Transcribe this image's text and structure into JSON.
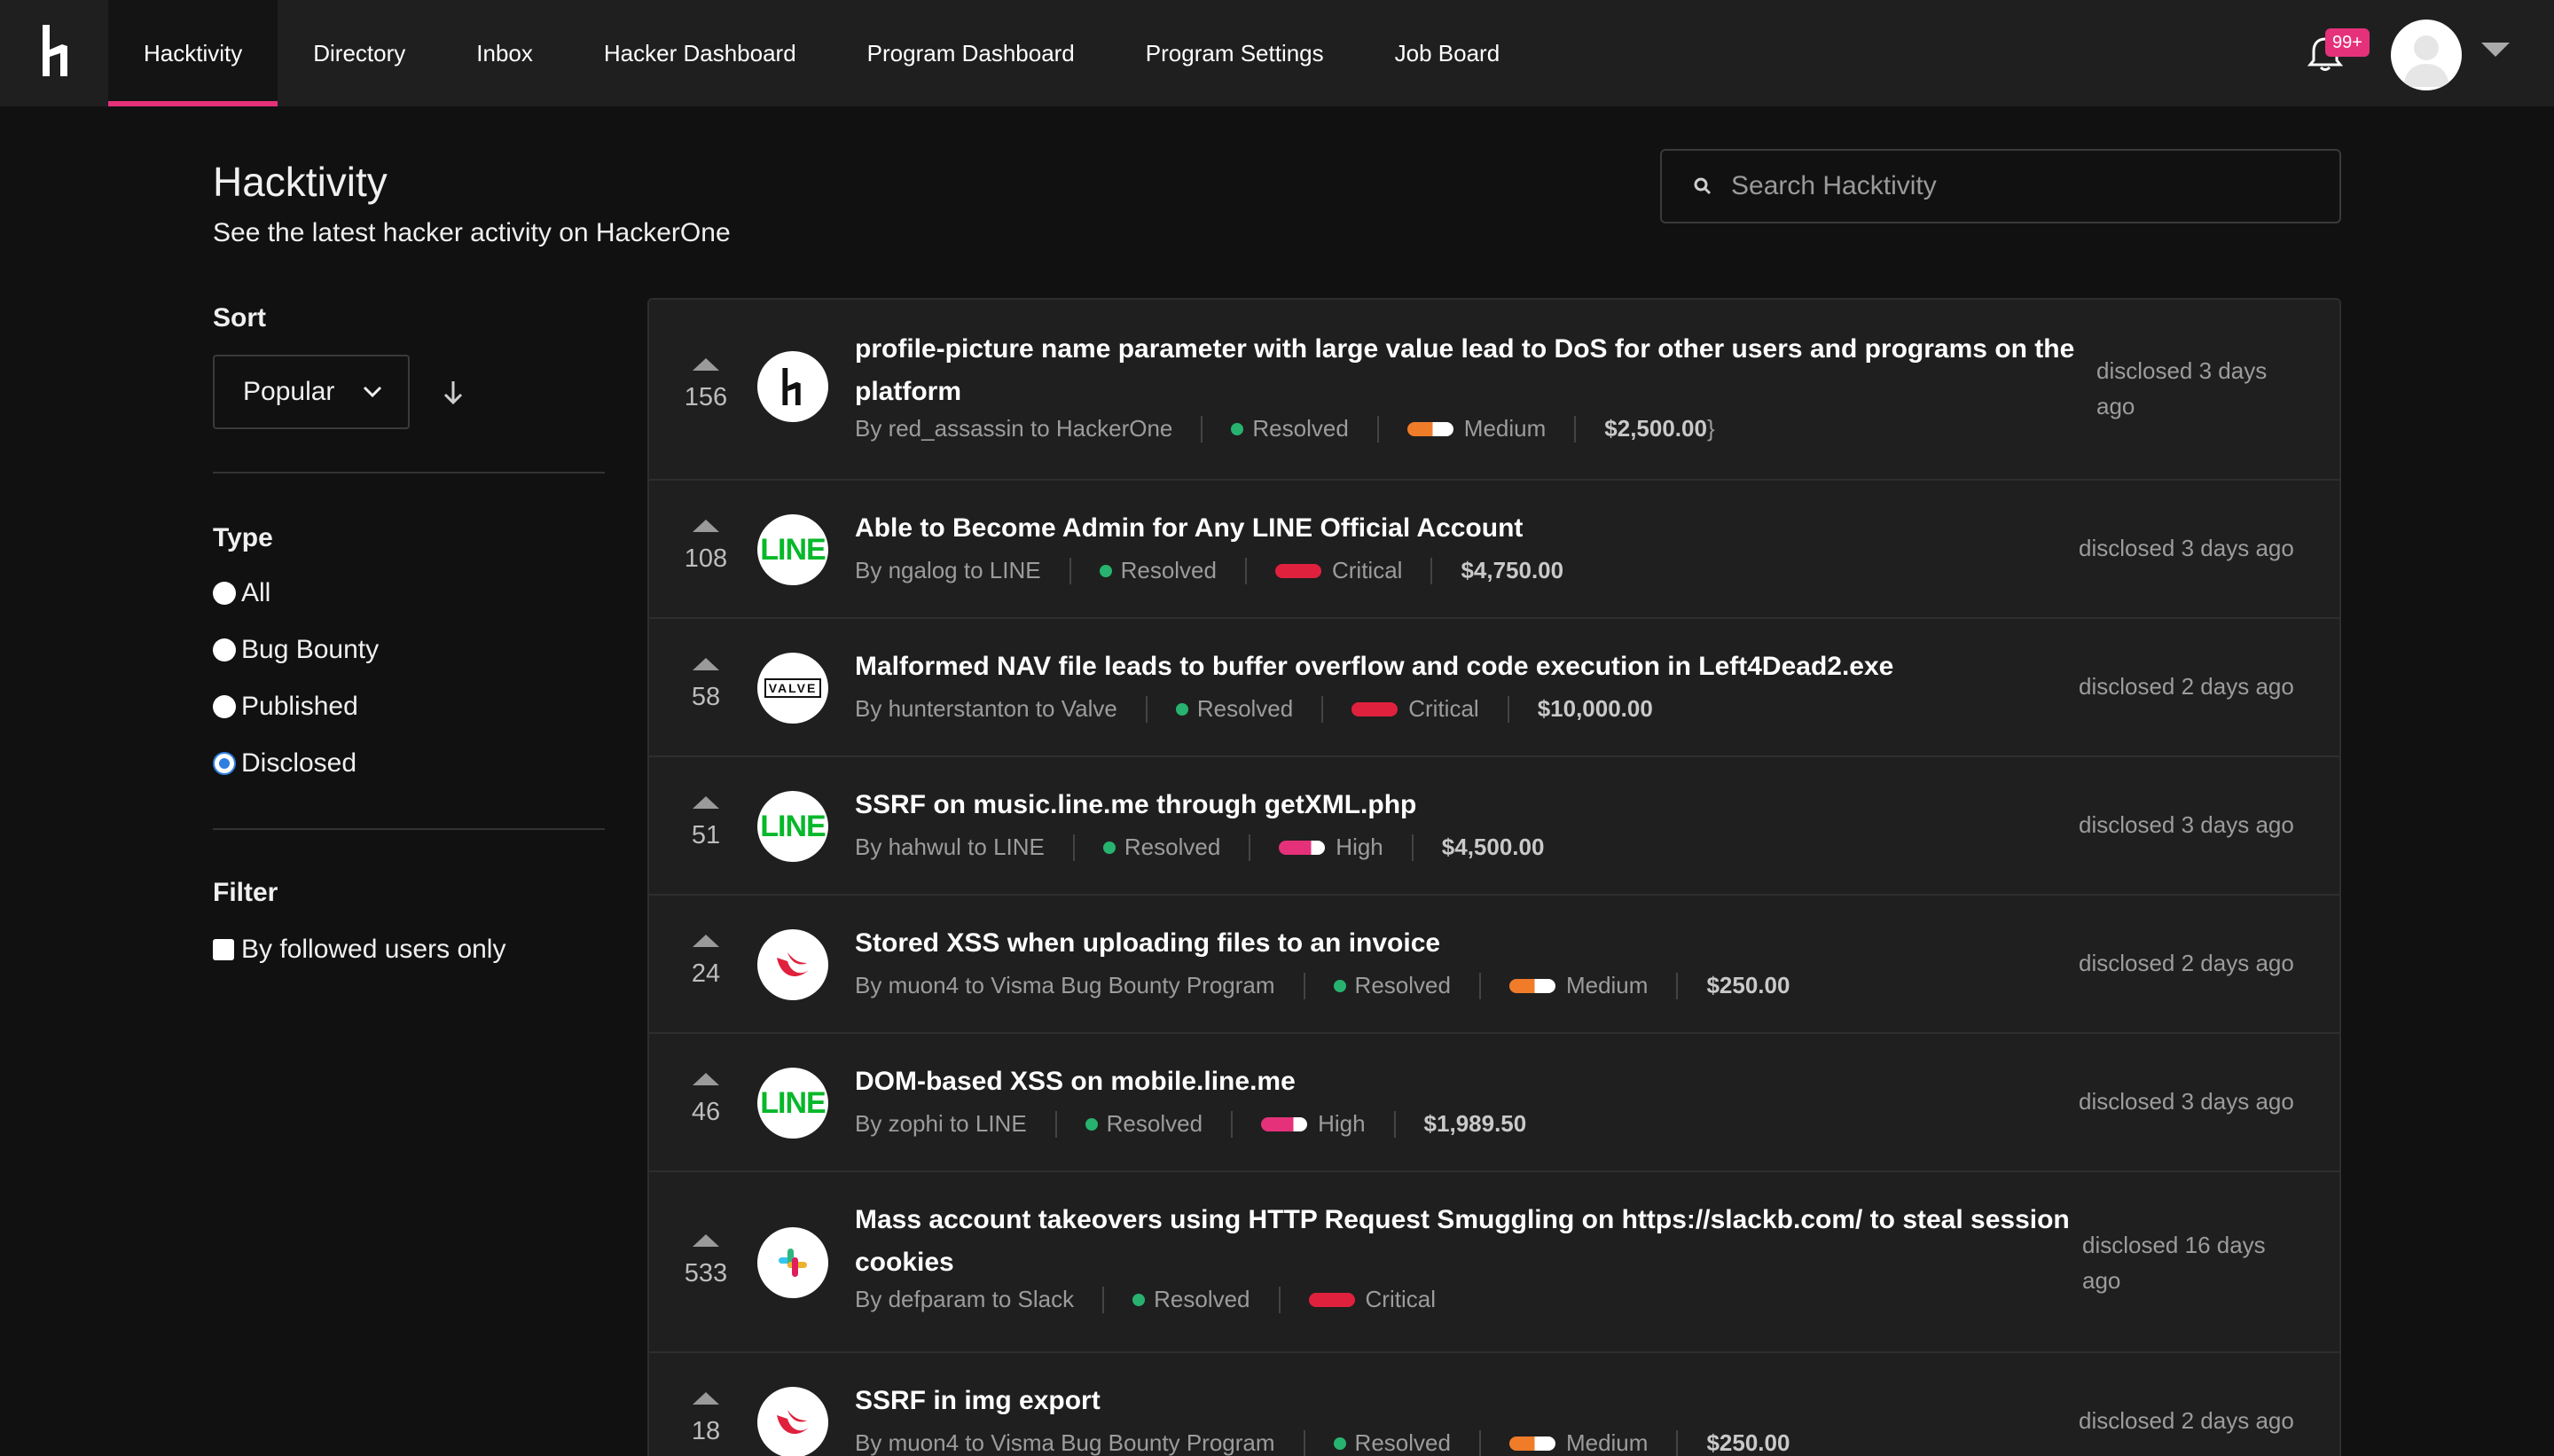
{
  "nav": {
    "tabs": [
      {
        "label": "Hacktivity",
        "active": true
      },
      {
        "label": "Directory"
      },
      {
        "label": "Inbox"
      },
      {
        "label": "Hacker Dashboard"
      },
      {
        "label": "Program Dashboard"
      },
      {
        "label": "Program Settings"
      },
      {
        "label": "Job Board"
      }
    ],
    "notification_badge": "99+",
    "accent_color": "#e5317a"
  },
  "header": {
    "title": "Hacktivity",
    "subtitle": "See the latest hacker activity on HackerOne",
    "search_placeholder": "Search Hacktivity"
  },
  "sidebar": {
    "sort_heading": "Sort",
    "sort_value": "Popular",
    "type_heading": "Type",
    "type_options": [
      {
        "label": "All",
        "selected": false
      },
      {
        "label": "Bug Bounty",
        "selected": false
      },
      {
        "label": "Published",
        "selected": false
      },
      {
        "label": "Disclosed",
        "selected": true
      }
    ],
    "filter_heading": "Filter",
    "filter_option": "By followed users only"
  },
  "reports": [
    {
      "votes": "156",
      "logo": "hackerone-icon",
      "title_lines": [
        "profile-picture name parameter with large value lead to DoS for other users and programs on the",
        "platform"
      ],
      "author": "By red_assassin to HackerOne",
      "state": "Resolved",
      "severity": "Medium",
      "bounty": "$2,500.00",
      "disclosed_lines": [
        "disclosed 3 days",
        "ago"
      ]
    },
    {
      "votes": "108",
      "logo": "line-icon",
      "title_lines": [
        "Able to Become Admin for Any LINE Official Account"
      ],
      "author": "By ngalog to LINE",
      "state": "Resolved",
      "severity": "Critical",
      "bounty": "$4,750.00",
      "disclosed_lines": [
        "disclosed 3 days ago"
      ]
    },
    {
      "votes": "58",
      "logo": "valve-icon",
      "title_lines": [
        "Malformed NAV file leads to buffer overflow and code execution in Left4Dead2.exe"
      ],
      "author": "By hunterstanton to Valve",
      "state": "Resolved",
      "severity": "Critical",
      "bounty": "$10,000.00",
      "disclosed_lines": [
        "disclosed 2 days ago"
      ]
    },
    {
      "votes": "51",
      "logo": "line-icon",
      "title_lines": [
        "SSRF on music.line.me through getXML.php"
      ],
      "author": "By hahwul to LINE",
      "state": "Resolved",
      "severity": "High",
      "bounty": "$4,500.00",
      "disclosed_lines": [
        "disclosed 3 days ago"
      ]
    },
    {
      "votes": "24",
      "logo": "visma-icon",
      "title_lines": [
        "Stored XSS when uploading files to an invoice"
      ],
      "author": "By muon4 to Visma Bug Bounty Program",
      "state": "Resolved",
      "severity": "Medium",
      "bounty": "$250.00",
      "disclosed_lines": [
        "disclosed 2 days ago"
      ]
    },
    {
      "votes": "46",
      "logo": "line-icon",
      "title_lines": [
        "DOM-based XSS on mobile.line.me"
      ],
      "author": "By zophi to LINE",
      "state": "Resolved",
      "severity": "High",
      "bounty": "$1,989.50",
      "disclosed_lines": [
        "disclosed 3 days ago"
      ]
    },
    {
      "votes": "533",
      "logo": "slack-icon",
      "title_lines": [
        "Mass account takeovers using HTTP Request Smuggling on https://slackb.com/ to steal session",
        "cookies"
      ],
      "author": "By defparam to Slack",
      "state": "Resolved",
      "severity": "Critical",
      "bounty": "",
      "disclosed_lines": [
        "disclosed 16 days",
        "ago"
      ]
    },
    {
      "votes": "18",
      "logo": "visma-icon",
      "title_lines": [
        "SSRF in img export"
      ],
      "author": "By muon4 to Visma Bug Bounty Program",
      "state": "Resolved",
      "severity": "Medium",
      "bounty": "$250.00",
      "disclosed_lines": [
        "disclosed 2 days ago"
      ]
    }
  ],
  "line_logo_text": "LINE",
  "valve_logo_text": "VALVE"
}
